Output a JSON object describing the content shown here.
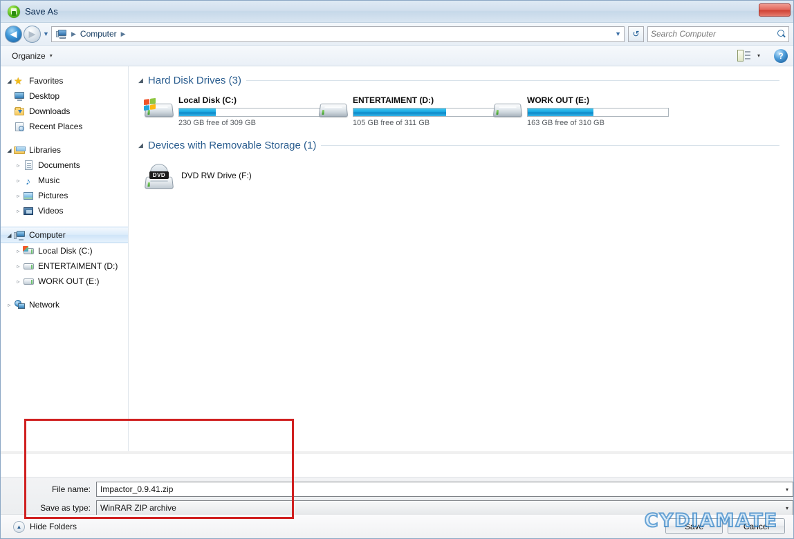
{
  "window": {
    "title": "Save As",
    "title_icon": "app-green-icon",
    "close_label": "",
    "close_icon": "close-icon"
  },
  "address_bar": {
    "back_icon": "back-arrow-icon",
    "forward_icon": "forward-arrow-icon",
    "history_icon": "chevron-down-icon",
    "breadcrumb_icon": "computer-icon",
    "breadcrumb": [
      "Computer"
    ],
    "breadcrumb_sep": "▸",
    "dropdown_icon": "chevron-down-icon",
    "refresh_icon": "refresh-icon",
    "refresh_glyph": "↺",
    "search_placeholder": "Search Computer",
    "search_value": "",
    "search_icon": "search-icon"
  },
  "toolbar": {
    "organize_label": "Organize",
    "organize_caret": "▾",
    "view_icon": "view-options-icon",
    "view_caret": "▾",
    "help_label": "?",
    "help_icon": "help-icon"
  },
  "sidebar": {
    "groups": [
      {
        "name": "favorites",
        "root": {
          "label": "Favorites",
          "icon": "star-icon",
          "expander": "◢"
        },
        "items": [
          {
            "label": "Desktop",
            "icon": "desktop-icon"
          },
          {
            "label": "Downloads",
            "icon": "downloads-folder-icon"
          },
          {
            "label": "Recent Places",
            "icon": "recent-places-icon"
          }
        ]
      },
      {
        "name": "libraries",
        "root": {
          "label": "Libraries",
          "icon": "library-icon",
          "expander": "◢"
        },
        "items": [
          {
            "label": "Documents",
            "icon": "documents-icon",
            "expander": "▹"
          },
          {
            "label": "Music",
            "icon": "music-icon",
            "expander": "▹"
          },
          {
            "label": "Pictures",
            "icon": "pictures-icon",
            "expander": "▹"
          },
          {
            "label": "Videos",
            "icon": "videos-icon",
            "expander": "▹"
          }
        ]
      },
      {
        "name": "computer",
        "root": {
          "label": "Computer",
          "icon": "computer-icon",
          "expander": "◢",
          "selected": true
        },
        "items": [
          {
            "label": "Local Disk (C:)",
            "icon": "hard-drive-windows-icon",
            "expander": "▹"
          },
          {
            "label": "ENTERTAIMENT (D:)",
            "icon": "hard-drive-icon",
            "expander": "▹"
          },
          {
            "label": "WORK OUT (E:)",
            "icon": "hard-drive-icon",
            "expander": "▹"
          }
        ]
      },
      {
        "name": "network",
        "root": {
          "label": "Network",
          "icon": "network-icon",
          "expander": "▹"
        },
        "items": []
      }
    ]
  },
  "content": {
    "groups": [
      {
        "title": "Hard Disk Drives (3)",
        "expander": "◢",
        "drives": [
          {
            "name": "Local Disk (C:)",
            "icon": "hard-drive-windows-icon",
            "free_text": "230 GB free of 309 GB",
            "free_gb": 230,
            "total_gb": 309,
            "used_percent": 26
          },
          {
            "name": "ENTERTAIMENT (D:)",
            "icon": "hard-drive-icon",
            "free_text": "105 GB free of 311 GB",
            "free_gb": 105,
            "total_gb": 311,
            "used_percent": 66
          },
          {
            "name": "WORK OUT (E:)",
            "icon": "hard-drive-icon",
            "free_text": "163 GB free of 310 GB",
            "free_gb": 163,
            "total_gb": 310,
            "used_percent": 47
          }
        ]
      },
      {
        "title": "Devices with Removable Storage (1)",
        "expander": "◢",
        "devices": [
          {
            "name": "DVD RW Drive (F:)",
            "icon": "dvd-drive-icon",
            "tag": "DVD"
          }
        ]
      }
    ]
  },
  "form": {
    "filename_label": "File name:",
    "filename_value": "Impactor_0.9.41.zip",
    "filename_caret": "▾",
    "filetype_label": "Save as type:",
    "filetype_value": "WinRAR ZIP archive",
    "filetype_caret": "▾",
    "hide_folders_label": "Hide Folders",
    "hide_folders_icon": "chevron-up-circle-icon",
    "save_label": "Save",
    "cancel_label": "Cancel",
    "watermark_text": "CYDIAMATE"
  },
  "colors": {
    "accent": "#2a5d8f",
    "drive_bar": "#1aa6e0",
    "annotation": "#d02020",
    "close_button": "#cf4134",
    "watermark": "#2f82c8"
  }
}
